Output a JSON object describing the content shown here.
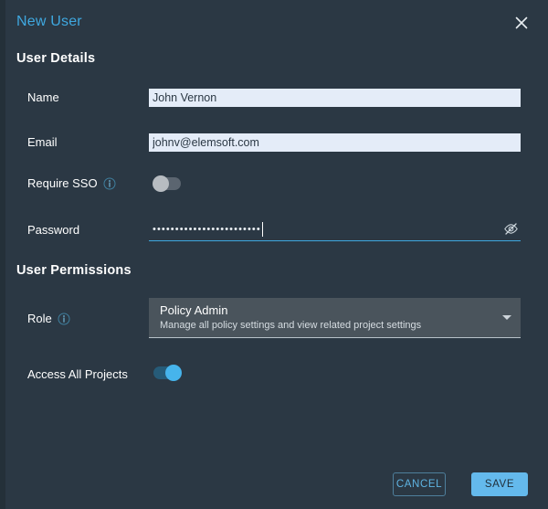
{
  "dialog": {
    "title": "New User",
    "close_icon": "close-icon"
  },
  "sections": {
    "details": {
      "title": "User Details"
    },
    "permissions": {
      "title": "User Permissions"
    }
  },
  "fields": {
    "name": {
      "label": "Name",
      "value": "John Vernon",
      "placeholder": ""
    },
    "email": {
      "label": "Email",
      "value": "johnv@elemsoft.com",
      "placeholder": ""
    },
    "require_sso": {
      "label": "Require SSO",
      "info_icon": "info-icon",
      "state": "off",
      "state_label": "Off"
    },
    "password": {
      "label": "Password",
      "value": "••••••••••••••••••••••••",
      "masked": true,
      "reveal_icon": "eye-off-icon"
    },
    "role": {
      "label": "Role",
      "info_icon": "info-icon",
      "selected": "Policy Admin",
      "selected_description": "Manage all policy settings and view related project settings",
      "caret_icon": "chevron-down-icon"
    },
    "access_all_projects": {
      "label": "Access All Projects",
      "state": "on",
      "state_label": "On"
    }
  },
  "footer": {
    "cancel_label": "CANCEL",
    "save_label": "SAVE"
  },
  "colors": {
    "background": "#2b3844",
    "accent": "#3fa8e0",
    "input_background": "#e4ecf8",
    "select_background": "#4a545c",
    "toggle_on": "#46b4ec",
    "toggle_off": "#b7bcc1",
    "save_button": "#64b9ec"
  }
}
